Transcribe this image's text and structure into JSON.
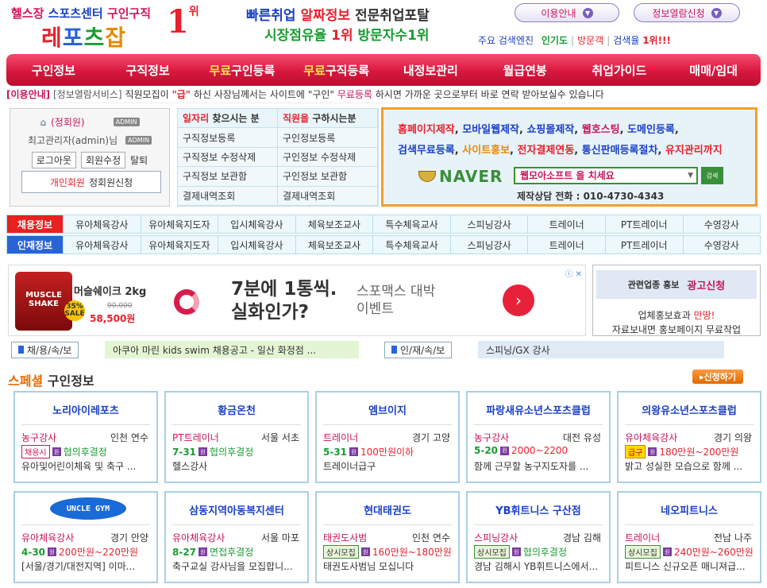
{
  "header": {
    "logo_top": [
      "헬스장",
      "스포츠센터",
      "구인구직"
    ],
    "logo_main": [
      "레",
      "포",
      "츠",
      "잡"
    ],
    "rank": "1",
    "rank_suffix": "위",
    "slogan1": [
      "빠른취업",
      "알짜정보",
      "전문취업포탈"
    ],
    "slogan2": [
      "시장점유율",
      "1위",
      "방문자수1위"
    ],
    "btn_guide": "이용안내",
    "btn_apply": "정보열람신청",
    "stats": {
      "label1": "주요 검색엔진",
      "v1": "인기도",
      "v2": "방문객",
      "v3": "검색율",
      "rank": "1위!!!"
    }
  },
  "nav": [
    {
      "pre": "",
      "label": "구인정보"
    },
    {
      "pre": "",
      "label": "구직정보"
    },
    {
      "pre": "무료",
      "label": "구인등록"
    },
    {
      "pre": "무료",
      "label": "구직등록"
    },
    {
      "pre": "",
      "label": "내정보관리"
    },
    {
      "pre": "",
      "label": "월급연봉"
    },
    {
      "pre": "",
      "label": "취업가이드"
    },
    {
      "pre": "",
      "label": "매매/임대"
    }
  ],
  "notice": {
    "tag": "[이용안내]",
    "service": "[정보열람서비스]",
    "t1": "직원모집이",
    "q1": "\"급\"",
    "t2": "하신 사장님께서는 사이트에",
    "q2": "\"구인\"",
    "reg": "무료등록",
    "t3": "하시면 가까운 곳으로부터 바로 연락 받아보실수 있습니다"
  },
  "login": {
    "role": "(정회원)",
    "admin_badge": "ADMIN",
    "name": "최고관리자(admin)님",
    "logout": "로그아웃",
    "edit": "회원수정",
    "leave": "탈퇴",
    "member_type": "개인회원",
    "member_apply": "정회원신청"
  },
  "menu": {
    "left_head": {
      "a": "일자리",
      "b": "찾으시는 분"
    },
    "right_head": {
      "a": "직원을",
      "b": "구하시는분"
    },
    "left": [
      "구직정보등록",
      "구직정보 수정삭제",
      "구직정보 보관함",
      "결제내역조회"
    ],
    "right": [
      "구인정보등록",
      "구인정보 수정삭제",
      "구인정보 보관함",
      "결제내역조회"
    ]
  },
  "ad": {
    "line1": [
      {
        "t": "홈페이지제작",
        "c": "c-r"
      },
      {
        "t": ", ",
        "c": ""
      },
      {
        "t": "모바일웹제작",
        "c": "c-b"
      },
      {
        "t": ", ",
        "c": ""
      },
      {
        "t": "쇼핑몰제작",
        "c": "c-b"
      },
      {
        "t": ", ",
        "c": ""
      },
      {
        "t": "웹호스팅",
        "c": "c-p"
      },
      {
        "t": ", ",
        "c": ""
      },
      {
        "t": "도메인등록",
        "c": "c-b"
      },
      {
        "t": ",",
        "c": ""
      }
    ],
    "line2": [
      {
        "t": "검색무료등록",
        "c": "c-b"
      },
      {
        "t": ", ",
        "c": ""
      },
      {
        "t": "사이트홍보",
        "c": "c-o"
      },
      {
        "t": ", ",
        "c": ""
      },
      {
        "t": "전자결제연동",
        "c": "c-r"
      },
      {
        "t": ", ",
        "c": ""
      },
      {
        "t": "통신판매등록절차",
        "c": "c-b"
      },
      {
        "t": ", ",
        "c": ""
      },
      {
        "t": "유지관리까지",
        "c": "c-r"
      }
    ],
    "naver": "NAVER",
    "search": "웹모아소프트 을 치세요",
    "search_btn": "검색",
    "tel": "제작상담 전화 : 010-4730-4343"
  },
  "categories": [
    {
      "head": "채용정보",
      "color": "#e82020",
      "items": [
        "유아체육강사",
        "유아체육지도자",
        "입시체육강사",
        "체육보조교사",
        "특수체육교사",
        "스피닝강사",
        "트레이너",
        "PT트레이너",
        "수영강사"
      ]
    },
    {
      "head": "인재정보",
      "color": "#2a63d8",
      "items": [
        "유아체육강사",
        "유아체육지도자",
        "입시체육강사",
        "체육보조교사",
        "특수체육교사",
        "스피닝강사",
        "트레이너",
        "PT트레이너",
        "수영강사"
      ]
    }
  ],
  "banner": {
    "product_top": "머슬쉐이크 2kg",
    "product_label": "MUSCLE SHAKE",
    "sale": "35% SALE",
    "old_price": "90,000",
    "price": "58,500원",
    "main1": "7분에 1통씩.",
    "main2": "실화인가?",
    "sub1": "스포맥스 대박",
    "sub2": "이벤트",
    "go": "›",
    "info": "ⓘ ✕"
  },
  "promo": {
    "head_small": "관련업종 홍보",
    "head_big": "광고신청",
    "t1a": "업체홍보효과",
    "t1b": "만땅!",
    "t2": "자료보내면 홍보페이지 무료작업"
  },
  "ticker": {
    "tag1": "채/용/속/보",
    "text1": "아쿠아 마린 kids swim 채용공고 - 일산 화정점 ...",
    "tag2": "인/재/속/보",
    "text2": "스피닝/GX 강사"
  },
  "special": {
    "title_a": "스페셜",
    "title_b": "구인정보",
    "apply": "신청하기"
  },
  "cards": [
    {
      "name": "노리아이레포츠",
      "job": "농구강사",
      "loc": "인천 연수",
      "badge": "채용시",
      "badge_type": "",
      "pay": "협의후결정",
      "pay_c": "g",
      "date": "",
      "desc": "유아및어린이체육 및 축구 ..."
    },
    {
      "name": "황금온천",
      "job": "PT트레이너",
      "loc": "서울 서초",
      "badge": "",
      "badge_type": "",
      "date": "7-31",
      "pay": "협의후결정",
      "pay_c": "g",
      "desc": "헬스강사"
    },
    {
      "name": "엠브이지",
      "job": "트레이너",
      "loc": "경기 고양",
      "badge": "",
      "badge_type": "",
      "date": "5-31",
      "pay": "100만원이하",
      "pay_c": "",
      "desc": "트레이너급구"
    },
    {
      "name": "파랑새유소년스포츠클럽",
      "job": "농구강사",
      "loc": "대전 유성",
      "badge": "",
      "badge_type": "",
      "date": "5-20",
      "pay": "2000~2200",
      "pay_c": "",
      "desc": "함께 근무할 농구지도자를 ..."
    },
    {
      "name": "의왕유소년스포츠클럽",
      "job": "유아체육강사",
      "loc": "경기 의왕",
      "badge": "급구",
      "badge_type": "y",
      "date": "",
      "pay": "180만원~200만원",
      "pay_c": "",
      "desc": "밝고 성실한 모습으로 함께 ..."
    },
    {
      "name": "UNCLE GYM",
      "logo": true,
      "job": "유아체육강사",
      "loc": "경기 안양",
      "badge": "",
      "badge_type": "",
      "date": "4-30",
      "pay": "200만원~220만원",
      "pay_c": "",
      "desc": "[서울/경기/대전지역] 이마..."
    },
    {
      "name": "삼동지역아동복지센터",
      "job": "유아체육강사",
      "loc": "서울 마포",
      "badge": "",
      "badge_type": "",
      "date": "8-27",
      "pay": "면접후결정",
      "pay_c": "g",
      "desc": "축구교실 강사님을 모집합니..."
    },
    {
      "name": "현대태권도",
      "job": "태권도사범",
      "loc": "인천 연수",
      "badge": "상시모집",
      "badge_type": "g",
      "date": "",
      "pay": "160만원~180만원",
      "pay_c": "",
      "desc": "태권도사범님 모십니다"
    },
    {
      "name": "YB휘트니스 구산점",
      "job": "스피닝강사",
      "loc": "경남 김해",
      "badge": "상시모집",
      "badge_type": "g",
      "date": "",
      "pay": "협의후결정",
      "pay_c": "g",
      "desc": "경남 김해시 YB휘트니스에서..."
    },
    {
      "name": "네오피트니스",
      "job": "트레이너",
      "loc": "전남 나주",
      "badge": "상시모집",
      "badge_type": "g",
      "date": "",
      "pay": "240만원~260만원",
      "pay_c": "",
      "desc": "피트니스 신규오픈 매니져급..."
    }
  ],
  "won_icon": "원"
}
